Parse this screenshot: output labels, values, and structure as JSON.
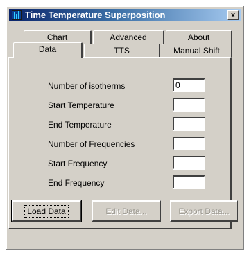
{
  "window": {
    "title": "Time Temperature Superposition",
    "close_label": "x"
  },
  "tabs": {
    "back_row": [
      "Chart",
      "Advanced",
      "About"
    ],
    "front_row": [
      "Data",
      "TTS",
      "Manual Shift"
    ],
    "selected": "Data"
  },
  "form": {
    "rows": [
      {
        "label": "Number of isotherms",
        "value": "0"
      },
      {
        "label": "Start Temperature",
        "value": ""
      },
      {
        "label": "End Temperature",
        "value": ""
      },
      {
        "label": "Number of Frequencies",
        "value": ""
      },
      {
        "label": "Start Frequency",
        "value": ""
      },
      {
        "label": "End Frequency",
        "value": ""
      }
    ]
  },
  "buttons": {
    "load": "Load Data",
    "edit": "Edit Data...",
    "export": "Export Data..."
  },
  "colors": {
    "face": "#d4d0c8",
    "title_start": "#0a246a",
    "title_end": "#a6caf0",
    "disabled_text": "#9a978f"
  },
  "icons": {
    "app": "chart-bars-icon",
    "close": "close-icon"
  }
}
